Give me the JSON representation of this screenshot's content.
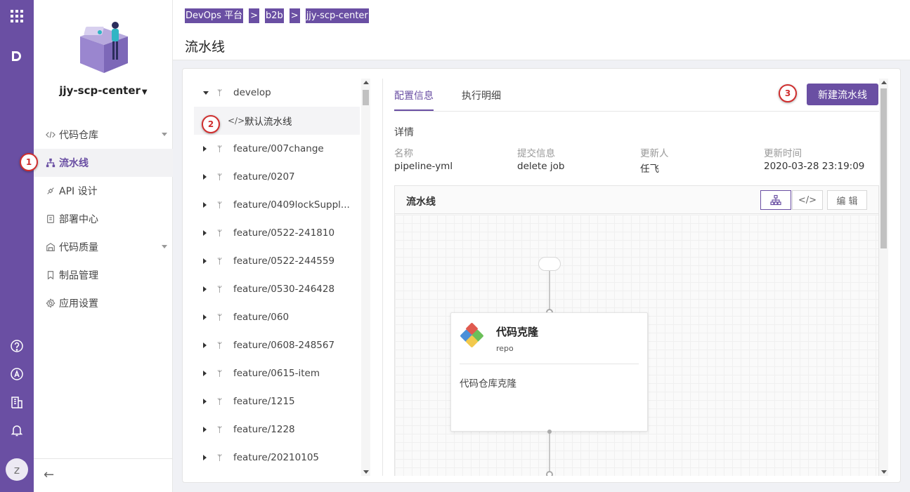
{
  "breadcrumb": {
    "items": [
      "DevOps 平台",
      "b2b",
      "jjy-scp-center"
    ],
    "separator": ">"
  },
  "page": {
    "title": "流水线"
  },
  "project": {
    "name": "jjy-scp-center"
  },
  "sidebar": {
    "items": [
      {
        "label": "代码仓库",
        "icon": "code-icon",
        "expandable": true
      },
      {
        "label": "流水线",
        "icon": "pipeline-icon",
        "active": true
      },
      {
        "label": "API 设计",
        "icon": "api-icon"
      },
      {
        "label": "部署中心",
        "icon": "deploy-icon"
      },
      {
        "label": "代码质量",
        "icon": "quality-icon",
        "expandable": true
      },
      {
        "label": "制品管理",
        "icon": "bookmark-icon"
      },
      {
        "label": "应用设置",
        "icon": "settings-icon"
      }
    ],
    "collapse_icon": "arrow-left-icon"
  },
  "rail": {
    "avatar_letter": "z"
  },
  "tree": {
    "rows": [
      {
        "label": "develop",
        "expanded": true
      },
      {
        "label": "默认流水线",
        "child": true,
        "selected": true
      },
      {
        "label": "feature/007change"
      },
      {
        "label": "feature/0207"
      },
      {
        "label": "feature/0409lockSuppl..."
      },
      {
        "label": "feature/0522-241810"
      },
      {
        "label": "feature/0522-244559"
      },
      {
        "label": "feature/0530-246428"
      },
      {
        "label": "feature/060"
      },
      {
        "label": "feature/0608-248567"
      },
      {
        "label": "feature/0615-item"
      },
      {
        "label": "feature/1215"
      },
      {
        "label": "feature/1228"
      },
      {
        "label": "feature/20210105"
      }
    ]
  },
  "tabs": [
    {
      "label": "配置信息",
      "active": true
    },
    {
      "label": "执行明细"
    }
  ],
  "new_pipeline_button": "新建流水线",
  "detail": {
    "title": "详情",
    "fields": [
      {
        "label": "名称",
        "value": "pipeline-yml"
      },
      {
        "label": "提交信息",
        "value": "delete job"
      },
      {
        "label": "更新人",
        "value": "任飞"
      },
      {
        "label": "更新时间",
        "value": "2020-03-28 23:19:09"
      }
    ]
  },
  "pipeline_panel": {
    "title": "流水线",
    "edit_label": "编 辑"
  },
  "task": {
    "name": "代码克隆",
    "subtitle": "repo",
    "description": "代码仓库克隆"
  },
  "annotations": [
    "1",
    "2",
    "3"
  ],
  "colors": {
    "brand": "#6a4fa3",
    "annotation": "#d02e2e"
  }
}
